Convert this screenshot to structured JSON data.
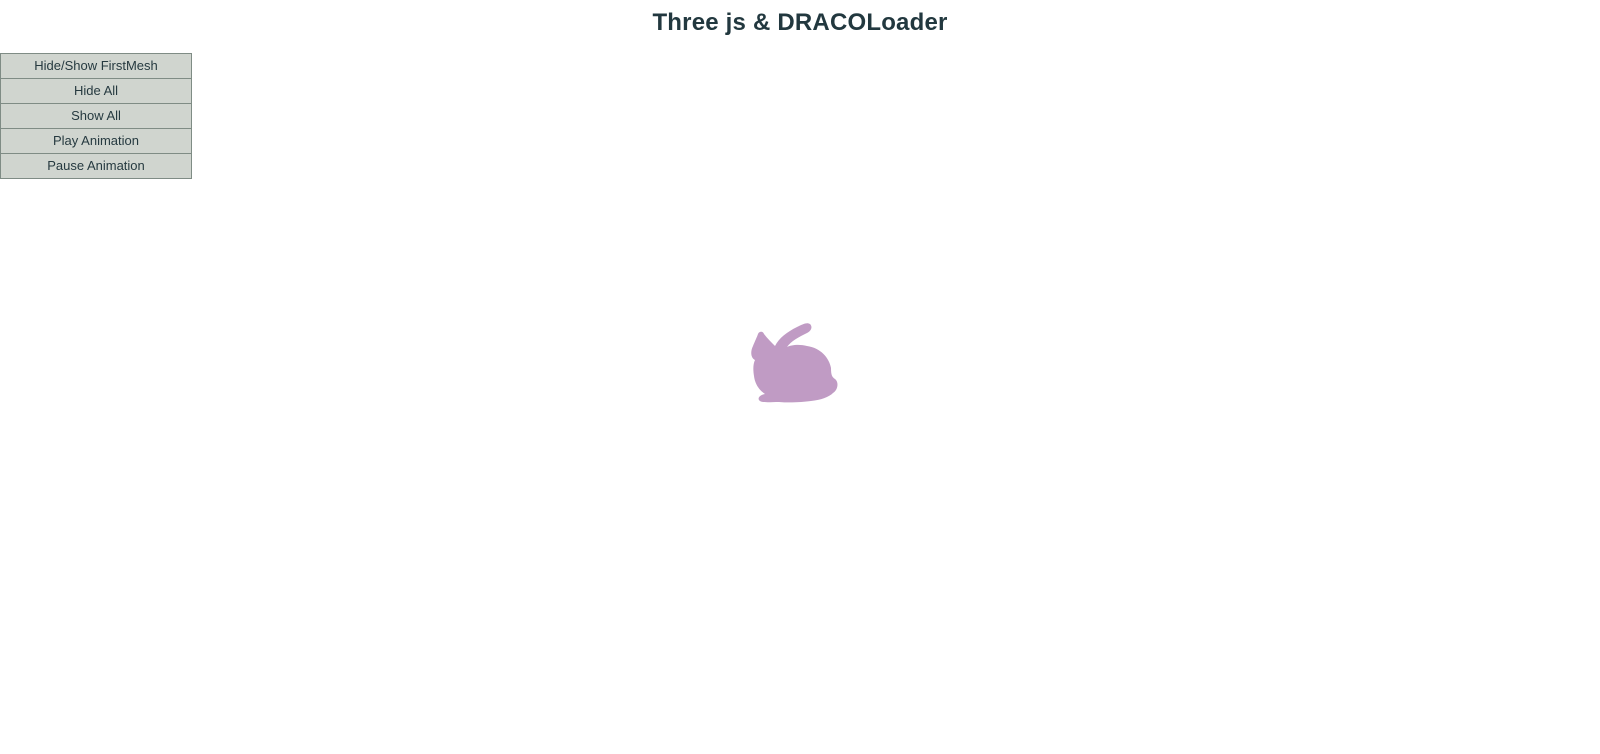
{
  "page": {
    "title": "Three js & DRACOLoader"
  },
  "controls": {
    "buttons": [
      {
        "label": "Hide/Show FirstMesh"
      },
      {
        "label": "Hide All"
      },
      {
        "label": "Show All"
      },
      {
        "label": "Play Animation"
      },
      {
        "label": "Pause Animation"
      }
    ]
  },
  "scene": {
    "mesh_color": "#c09bc4",
    "background_color": "#ffffff"
  }
}
